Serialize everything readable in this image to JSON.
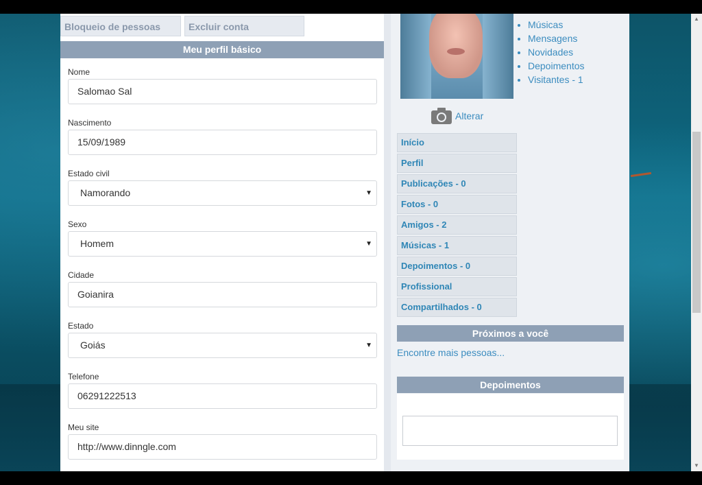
{
  "tabs": {
    "block": "Bloqueio de pessoas",
    "delete": "Excluir conta"
  },
  "profile_section": {
    "title": "Meu perfil básico",
    "fields": {
      "nome": {
        "label": "Nome",
        "value": "Salomao Sal"
      },
      "nascimento": {
        "label": "Nascimento",
        "value": "15/09/1989"
      },
      "estado_civil": {
        "label": "Estado civil",
        "value": "Namorando"
      },
      "sexo": {
        "label": "Sexo",
        "value": "Homem"
      },
      "cidade": {
        "label": "Cidade",
        "value": "Goianira"
      },
      "estado": {
        "label": "Estado",
        "value": "Goiás"
      },
      "telefone": {
        "label": "Telefone",
        "value": "06291222513"
      },
      "site": {
        "label": "Meu site",
        "value": "http://www.dinngle.com"
      }
    }
  },
  "sidebar": {
    "change_photo": "Alterar",
    "links": [
      "Músicas",
      "Mensagens",
      "Novidades",
      "Depoimentos",
      "Visitantes - 1"
    ],
    "menu": [
      "Início",
      "Perfil",
      "Publicações - 0",
      "Fotos - 0",
      "Amigos - 2",
      "Músicas - 1",
      "Depoimentos - 0",
      "Profissional",
      "Compartilhados - 0"
    ],
    "nearby_title": "Próximos a você",
    "find_more": "Encontre mais pessoas...",
    "testimonials_title": "Depoimentos"
  },
  "colors": {
    "accent": "#3b8cbf",
    "header": "#8ea0b5"
  }
}
